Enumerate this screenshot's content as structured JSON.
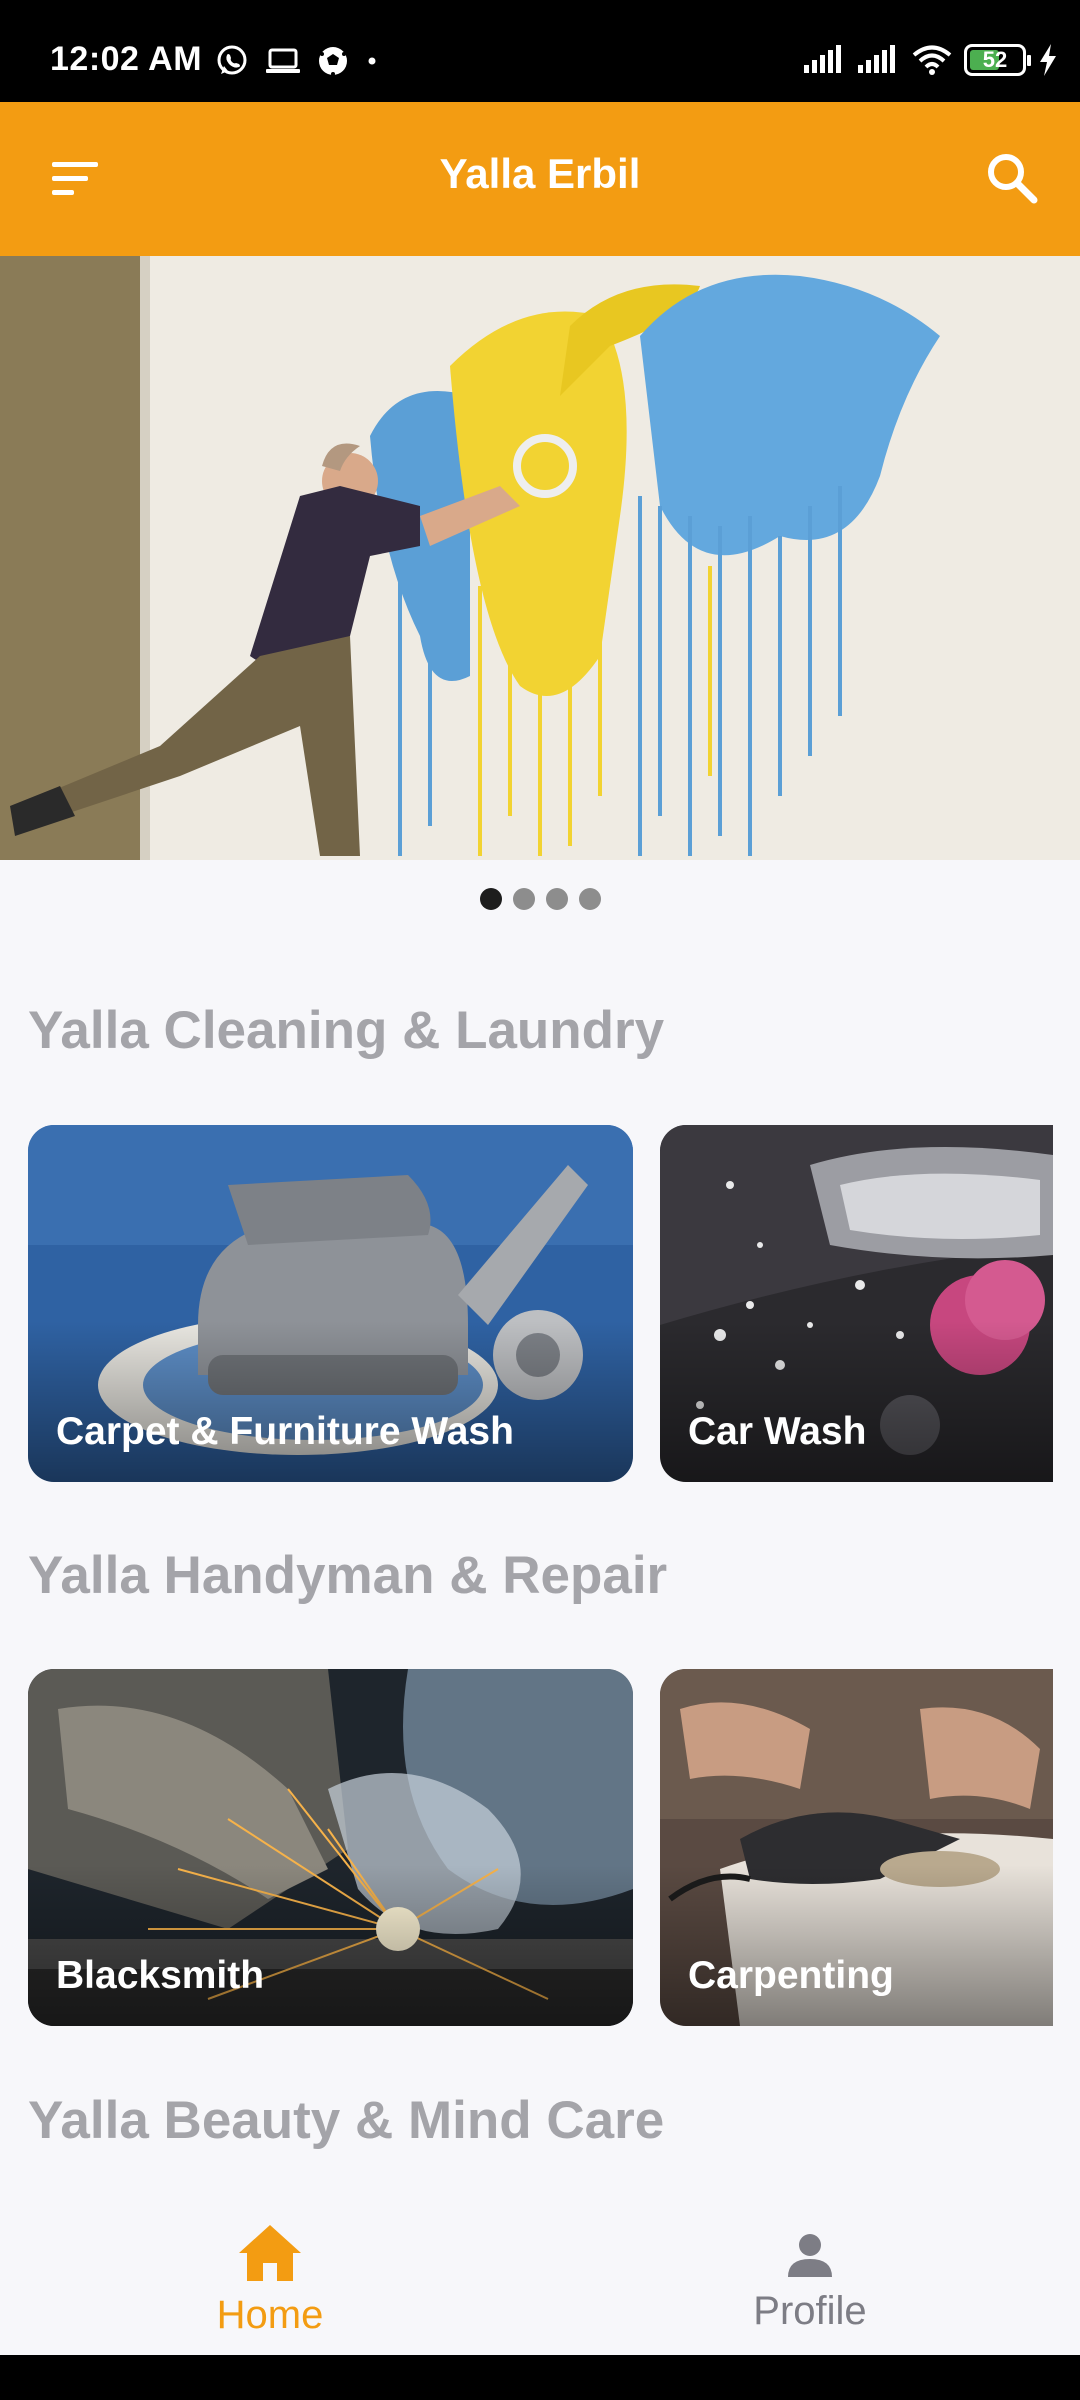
{
  "status_bar": {
    "time": "12:02 AM",
    "battery": "52",
    "icons": [
      "whatsapp-icon",
      "laptop-icon",
      "soccer-ball-icon",
      "dot-icon",
      "signal-icon",
      "signal-icon",
      "wifi-icon",
      "battery-icon",
      "charging-icon"
    ]
  },
  "app_bar": {
    "title": "Yalla Erbil",
    "menu_icon": "sort-menu-icon",
    "search_icon": "search-icon"
  },
  "carousel": {
    "slide_count": 4,
    "active_index": 0
  },
  "sections": [
    {
      "title": "Yalla Cleaning & Laundry",
      "cards": [
        {
          "label": "Carpet & Furniture Wash"
        },
        {
          "label": "Car Wash"
        }
      ]
    },
    {
      "title": "Yalla Handyman & Repair",
      "cards": [
        {
          "label": "Blacksmith"
        },
        {
          "label": "Carpenting"
        }
      ]
    },
    {
      "title": "Yalla Beauty & Mind Care",
      "cards": []
    }
  ],
  "bottom_nav": {
    "items": [
      {
        "label": "Home",
        "icon": "home-icon",
        "active": true
      },
      {
        "label": "Profile",
        "icon": "person-icon",
        "active": false
      }
    ]
  },
  "colors": {
    "accent": "#f39c12",
    "section_title": "#a4a4a9",
    "background": "#f7f7fa"
  }
}
